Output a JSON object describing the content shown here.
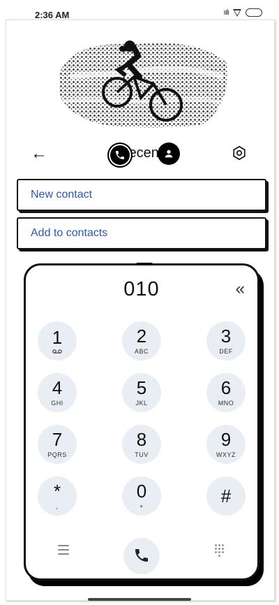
{
  "status": {
    "time": "2:36 AM",
    "signal": "ıılı"
  },
  "header": {
    "title": "Recents",
    "back_icon": "arrow-left-icon",
    "settings_icon": "settings-icon"
  },
  "actions": {
    "new_contact": "New contact",
    "add_to_contacts": "Add to contacts"
  },
  "dialpad": {
    "number": "010",
    "backspace": "«",
    "keys": [
      {
        "digit": "1",
        "letters": ""
      },
      {
        "digit": "2",
        "letters": "ABC"
      },
      {
        "digit": "3",
        "letters": "DEF"
      },
      {
        "digit": "4",
        "letters": "GHI"
      },
      {
        "digit": "5",
        "letters": "JKL"
      },
      {
        "digit": "6",
        "letters": "MNO"
      },
      {
        "digit": "7",
        "letters": "PQRS"
      },
      {
        "digit": "8",
        "letters": "TUV"
      },
      {
        "digit": "9",
        "letters": "WXYZ"
      },
      {
        "digit": "*",
        "letters": ","
      },
      {
        "digit": "0",
        "letters": "+"
      },
      {
        "digit": "#",
        "letters": ""
      }
    ]
  },
  "colors": {
    "accent": "#2a57b5",
    "key_bg": "#e9eef5"
  }
}
